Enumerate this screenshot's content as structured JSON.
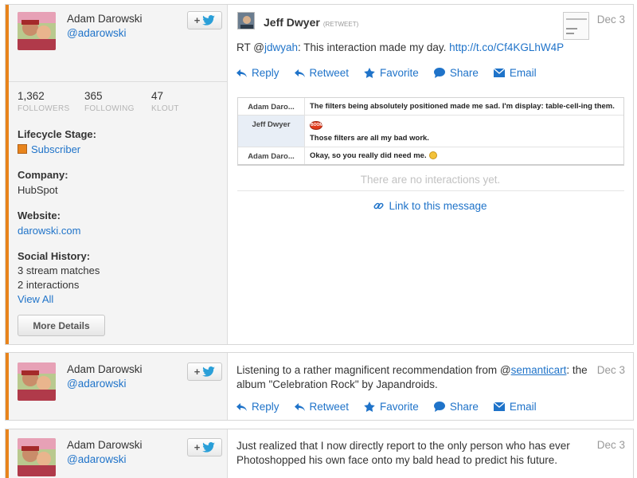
{
  "colors": {
    "accent": "#e8841c",
    "link": "#1f73c9",
    "muted": "#999999"
  },
  "cards": [
    {
      "profile": {
        "name": "Adam Darowski",
        "handle": "@adarowski"
      },
      "stats": [
        {
          "value": "1,362",
          "label": "FOLLOWERS"
        },
        {
          "value": "365",
          "label": "FOLLOWING"
        },
        {
          "value": "47",
          "label": "KLOUT"
        }
      ],
      "lifecycle": {
        "label": "Lifecycle Stage:",
        "value": "Subscriber"
      },
      "company": {
        "label": "Company:",
        "value": "HubSpot"
      },
      "website": {
        "label": "Website:",
        "value": "darowski.com"
      },
      "social": {
        "label": "Social History:",
        "matches": "3 stream matches",
        "interactions": "2 interactions",
        "view_all": "View All"
      },
      "more_details": "More Details",
      "message": {
        "author": "Jeff Dwyer",
        "tag": "(RETWEET)",
        "date": "Dec 3",
        "text_prefix": "RT @",
        "mention": "jdwyah",
        "text_body": ": This interaction made my day. ",
        "url": "http://t.co/Cf4KGLhW4P"
      },
      "interactions": [
        {
          "who": "Adam Daro...",
          "text": "The filters being absolutely positioned made me sad. I'm display: table-cell-ing them."
        },
        {
          "who": "Jeff Dwyer",
          "badge": "BOOM",
          "text": "Those filters are all my bad work."
        },
        {
          "who": "Adam Daro...",
          "text": "Okay, so you really did need me."
        }
      ],
      "no_interactions": "There are no interactions yet.",
      "link_message": "Link to this message"
    },
    {
      "profile": {
        "name": "Adam Darowski",
        "handle": "@adarowski"
      },
      "message": {
        "date": "Dec 3",
        "line1_prefix": "Listening to a rather magnificent recommendation from @",
        "mention": "semanticart",
        "line1_suffix": ": the",
        "line2": "album \"Celebration Rock\" by Japandroids."
      }
    },
    {
      "profile": {
        "name": "Adam Darowski",
        "handle": "@adarowski"
      },
      "message": {
        "date": "Dec 3",
        "line1": "Just realized that I now directly report to the only person who has ever",
        "line2": "Photoshopped his own face onto my bald head to predict his future."
      }
    }
  ],
  "actions": {
    "reply": "Reply",
    "retweet": "Retweet",
    "favorite": "Favorite",
    "share": "Share",
    "email": "Email"
  }
}
